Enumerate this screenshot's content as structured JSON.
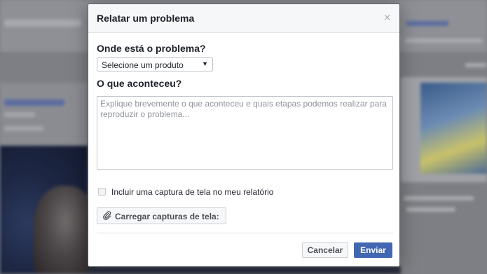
{
  "dialog": {
    "title": "Relatar um problema",
    "close_icon": "close-icon",
    "close_glyph": "×"
  },
  "form": {
    "where_label": "Onde está o problema?",
    "product_select": {
      "selected": "Selecione um produto",
      "arrow_glyph": "▼"
    },
    "what_label": "O que aconteceu?",
    "description": {
      "placeholder": "Explique brevemente o que aconteceu e quais etapas podemos realizar para reproduzir o problema...",
      "value": ""
    },
    "screenshot_checkbox": {
      "label": "Incluir uma captura de tela no meu relatório",
      "checked": false
    },
    "upload_button": {
      "label": "Carregar capturas de tela:",
      "icon": "paperclip-icon"
    }
  },
  "footer": {
    "cancel_label": "Cancelar",
    "send_label": "Enviar"
  },
  "colors": {
    "primary_button": "#4267b2",
    "overlay_background": "#7d7f84",
    "title_text": "#1d2129"
  }
}
